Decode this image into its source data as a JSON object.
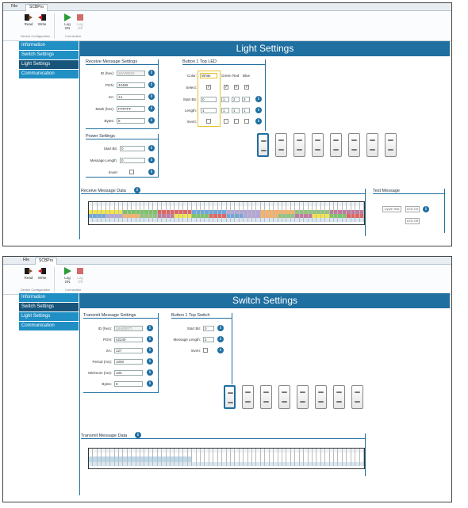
{
  "tabs": {
    "file": "File",
    "active": "SCBPro"
  },
  "ribbon": {
    "read": "Read",
    "write": "Write",
    "log_on": "Log\nON",
    "log_off": "Log\nOff",
    "group_device": "Device Configuration",
    "group_connection": "Connection"
  },
  "sidebar": {
    "items": [
      "Information",
      "Switch Settings",
      "Light Settings",
      "Communication"
    ]
  },
  "light": {
    "title": "Light Settings",
    "receive": {
      "heading": "Receive Message Settings",
      "fields": [
        {
          "label": "ID (hex):",
          "value": "18A00022"
        },
        {
          "label": "PGN:",
          "value": "42496"
        },
        {
          "label": "SA:",
          "value": "14"
        },
        {
          "label": "Mask (hex):",
          "value": "FFFFFF"
        },
        {
          "label": "Bytes:",
          "value": "8"
        }
      ]
    },
    "power": {
      "heading": "Power Settings",
      "fields": [
        {
          "label": "Start Bit:",
          "value": "0"
        },
        {
          "label": "Message Length:",
          "value": "0"
        }
      ],
      "invert": "Invert"
    },
    "led": {
      "heading": "Button 1 Top LED",
      "color_label": "Color:",
      "color_value": "White",
      "col_green": "Green",
      "col_red": "Red",
      "col_blue": "Blue",
      "rows": [
        "Select:",
        "Start Bit:",
        "Length:",
        "Invert:"
      ],
      "start_vals": [
        "0",
        "1",
        "2",
        "3"
      ],
      "length_vals": [
        "1",
        "1",
        "1",
        "1"
      ]
    },
    "receive_data": {
      "heading": "Receive Message Data"
    },
    "test": {
      "heading": "Test Message",
      "cycle": "Cycle Test",
      "led_on": "LED On",
      "led_off": "LED Off"
    }
  },
  "switch": {
    "title": "Switch Settings",
    "transmit": {
      "heading": "Transmit Message Settings",
      "fields": [
        {
          "label": "ID (hex):",
          "value": "18A00077"
        },
        {
          "label": "PGN:",
          "value": "42240"
        },
        {
          "label": "SA:",
          "value": "127"
        },
        {
          "label": "Period (ms):",
          "value": "1000"
        },
        {
          "label": "Minimum (ms):",
          "value": "100"
        },
        {
          "label": "Bytes:",
          "value": "8"
        }
      ]
    },
    "button": {
      "heading": "Button 1 Top Switch",
      "fields": [
        {
          "label": "Start Bit:",
          "value": "0"
        },
        {
          "label": "Message Length:",
          "value": "2"
        }
      ],
      "invert": "Invert:"
    },
    "transmit_data": {
      "heading": "Transmit Message Data"
    }
  },
  "colors": {
    "accent": "#1f6fa0",
    "nav": "#1f8fc4",
    "nav_selected": "#17557a",
    "highlight": "#e5c12a"
  },
  "icons": {
    "read": "read-icon",
    "write": "write-icon",
    "log_on": "play-icon",
    "log_off": "stop-icon"
  }
}
